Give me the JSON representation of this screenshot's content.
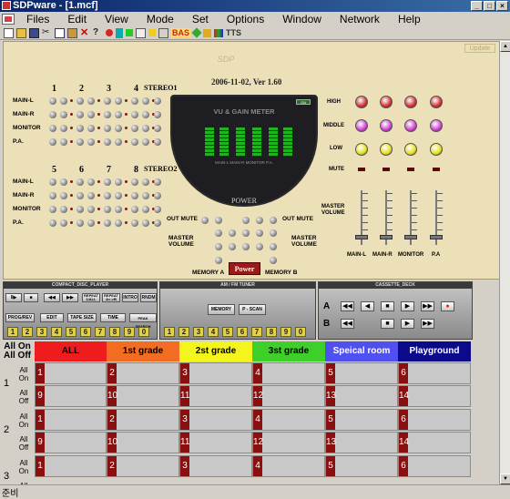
{
  "window": {
    "title": "SDPware - [1.mcf]",
    "min": "_",
    "max": "□",
    "close": "×"
  },
  "menu": [
    "Files",
    "Edit",
    "View",
    "Mode",
    "Set",
    "Options",
    "Window",
    "Network",
    "Help"
  ],
  "toolbar": {
    "bas_label": "BAS",
    "tts_label": "TTS"
  },
  "mixer": {
    "update_label": "Update",
    "logo": "SDP",
    "version": "2006-11-02, Ver 1.60",
    "stereo1": "STEREO1",
    "stereo2": "STEREO2",
    "row_labels": [
      "MAIN-L",
      "MAIN-R",
      "MONITOR",
      "P.A."
    ],
    "group1_channels": [
      "1",
      "2",
      "3",
      "4"
    ],
    "group2_channels": [
      "5",
      "6",
      "7",
      "8"
    ],
    "meter_title": "VU & GAIN METER",
    "meter_on": "ON",
    "meter_bottom": "MAIN-L  MAIN-R  MONITOR  P.A.",
    "meter_power": "POWER",
    "out_mute_left": "OUT MUTE",
    "out_mute_right": "OUT MUTE",
    "master_volume_left": "MASTER VOLUME",
    "master_volume_right": "MASTER VOLUME",
    "memory_a": "MEMORY A",
    "memory_b": "MEMORY B",
    "power_button": "Power",
    "eq_labels": [
      "HIGH",
      "MIDDLE",
      "LOW",
      "MUTE"
    ],
    "master_volume_eq": "MASTER VOLUME",
    "fader_labels": [
      "MAIN-L",
      "MAIN-R",
      "MONITOR",
      "P.A"
    ],
    "colors": {
      "high": "#d03030",
      "middle": "#d040d0",
      "low": "#e8e020"
    }
  },
  "cd": {
    "title": "COMPACT_DISC_PLAYER",
    "buttons_row1": [
      "II▶",
      "■",
      "◀◀",
      "▶▶",
      "REPEAT 1/ALL",
      "REPEAT A<->B",
      "INTRO",
      "RNDM"
    ],
    "buttons_row2": [
      "PROG/REV",
      "EDIT",
      "TAPE SIZE",
      "TIME",
      "PEAK SEARCH"
    ],
    "numbers": [
      "1",
      "2",
      "3",
      "4",
      "5",
      "6",
      "7",
      "8",
      "9",
      "0"
    ]
  },
  "tuner": {
    "title": "AM / FM  TUNER",
    "memory": "MEMORY",
    "pscan": "P - SCAN",
    "numbers": [
      "1",
      "2",
      "3",
      "4",
      "5",
      "6",
      "7",
      "8",
      "9",
      "0"
    ]
  },
  "cassette": {
    "title": "CASSETTE_DECK",
    "deck_a": "A",
    "deck_b": "B",
    "row_a": [
      "◀◀",
      "◀",
      "■",
      "▶",
      "▶▶",
      "●"
    ],
    "row_b": [
      "◀◀",
      "■",
      "▶",
      "▶▶"
    ]
  },
  "zones": {
    "all_on": "All On",
    "all_off": "All Off",
    "headers": [
      {
        "label": "ALL",
        "color": "#ee1c1c",
        "text": "#000"
      },
      {
        "label": "1st grade",
        "color": "#f26d21",
        "text": "#000"
      },
      {
        "label": "2st grade",
        "color": "#f5f51e",
        "text": "#000"
      },
      {
        "label": "3st grade",
        "color": "#3fcf2b",
        "text": "#000"
      },
      {
        "label": "Speical room",
        "color": "#5050f0",
        "text": "#fff"
      },
      {
        "label": "Playground",
        "color": "#0a0a8a",
        "text": "#fff"
      }
    ],
    "rows": [
      {
        "num": "1",
        "on_label": "All On",
        "off_label": "All Off",
        "on_cells": [
          "1",
          "2",
          "3",
          "4",
          "5",
          "6"
        ],
        "off_cells": [
          "9",
          "10",
          "11",
          "12",
          "13",
          "14"
        ]
      },
      {
        "num": "2",
        "on_label": "All On",
        "off_label": "All Off",
        "on_cells": [
          "1",
          "2",
          "3",
          "4",
          "5",
          "6"
        ],
        "off_cells": [
          "9",
          "10",
          "11",
          "12",
          "13",
          "14"
        ]
      },
      {
        "num": "3",
        "on_label": "All On",
        "off_label": "All Off",
        "on_cells": [
          "1",
          "2",
          "3",
          "4",
          "5",
          "6"
        ],
        "off_cells": []
      }
    ]
  },
  "status": {
    "text": "준비"
  }
}
